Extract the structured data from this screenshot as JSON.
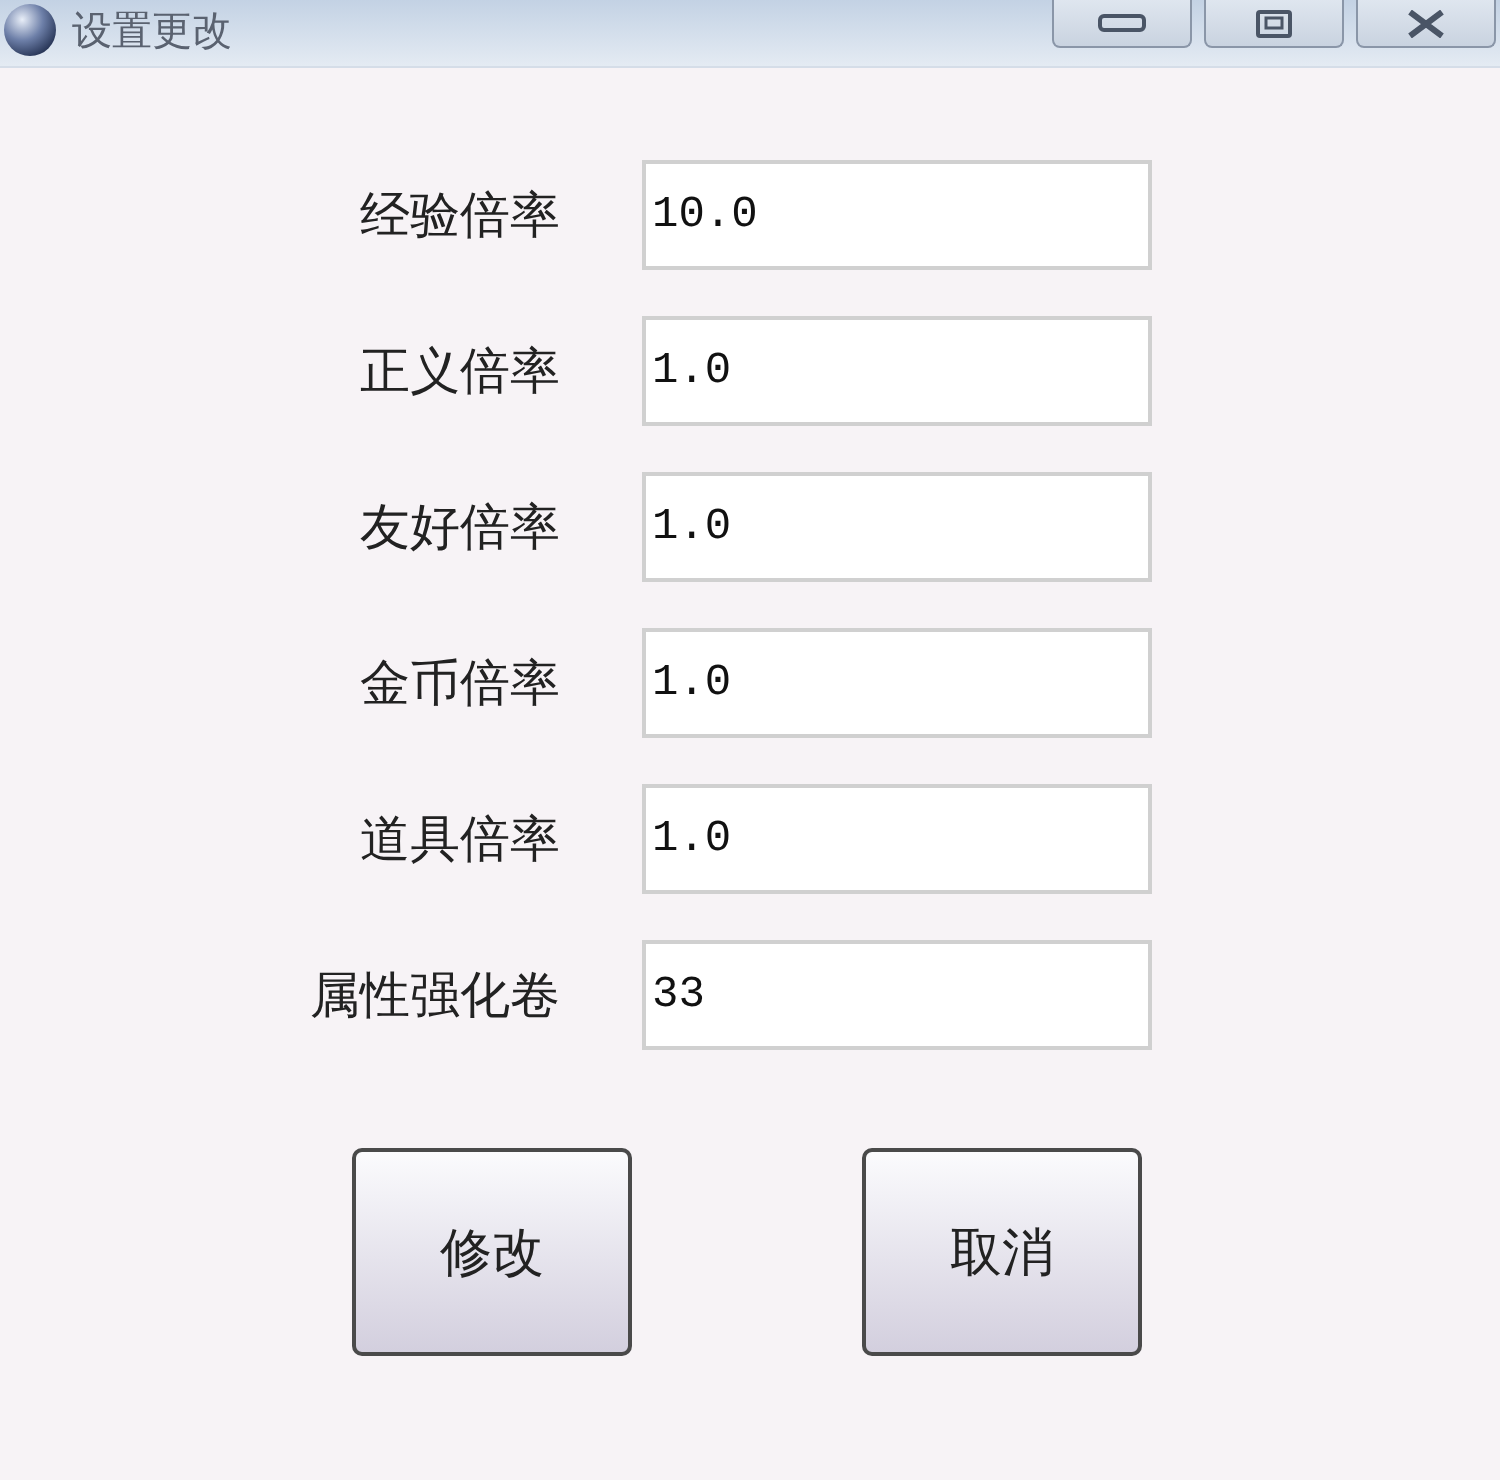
{
  "window": {
    "title": "设置更改"
  },
  "fields": [
    {
      "label": "经验倍率",
      "value": "10.0"
    },
    {
      "label": "正义倍率",
      "value": "1.0"
    },
    {
      "label": "友好倍率",
      "value": "1.0"
    },
    {
      "label": "金币倍率",
      "value": "1.0"
    },
    {
      "label": "道具倍率",
      "value": "1.0"
    },
    {
      "label": "属性强化卷",
      "value": "33"
    }
  ],
  "buttons": [
    {
      "label": "修改"
    },
    {
      "label": "取消"
    }
  ]
}
